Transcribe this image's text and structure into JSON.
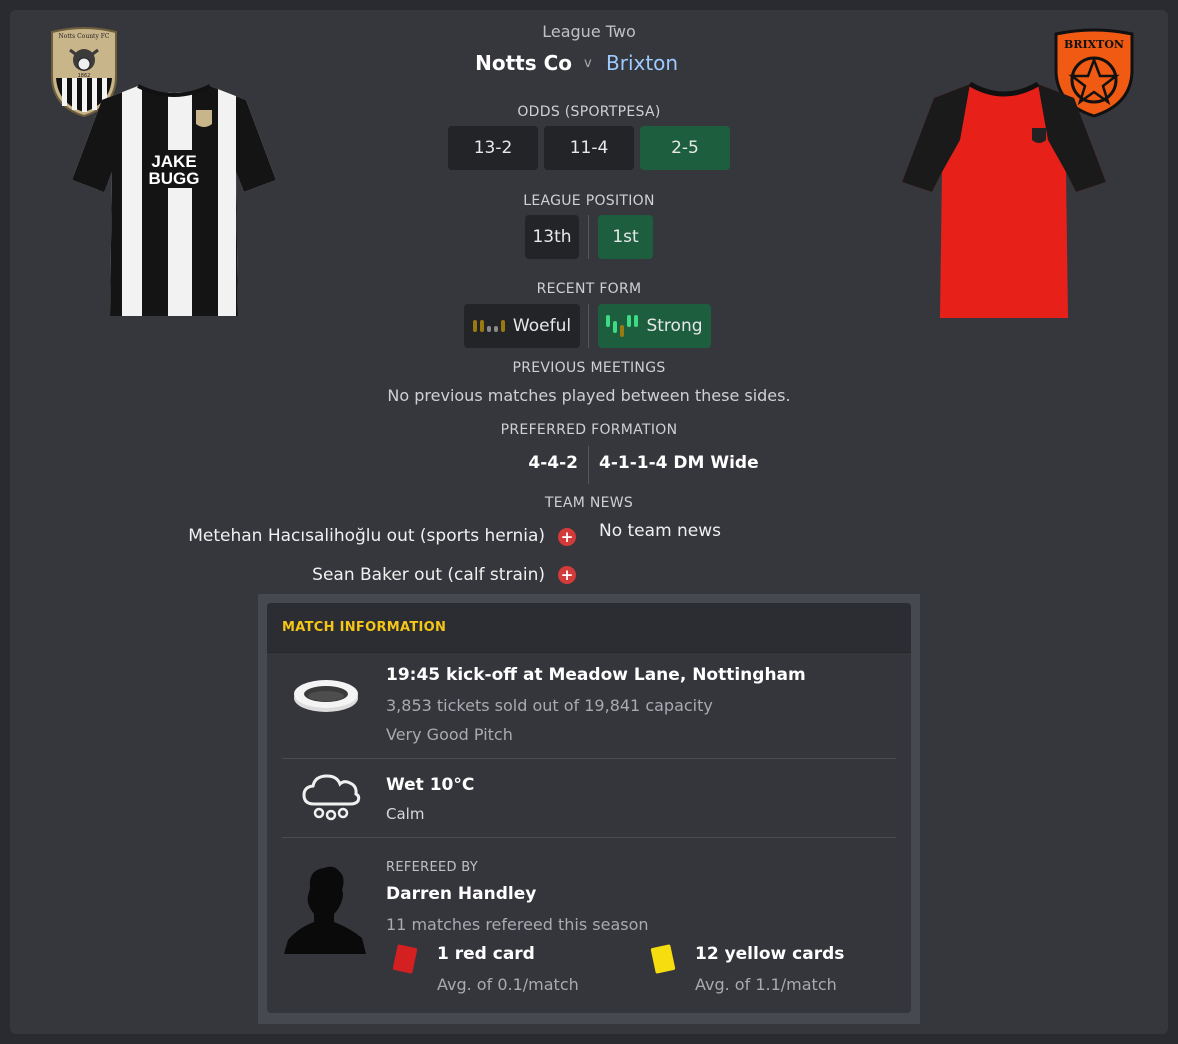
{
  "match": {
    "competition": "League Two",
    "home_team": "Notts Co",
    "vs": "v",
    "away_team": "Brixton"
  },
  "odds": {
    "label": "ODDS (SPORTPESA)",
    "home": "13-2",
    "draw": "11-4",
    "away": "2-5"
  },
  "league_position": {
    "label": "LEAGUE POSITION",
    "home": "13th",
    "away": "1st"
  },
  "recent_form": {
    "label": "RECENT FORM",
    "home": "Woeful",
    "away": "Strong"
  },
  "previous_meetings": {
    "label": "PREVIOUS MEETINGS",
    "text": "No previous matches played between these sides."
  },
  "preferred_formation": {
    "label": "PREFERRED FORMATION",
    "home": "4-4-2",
    "away": "4-1-1-4 DM Wide"
  },
  "team_news": {
    "label": "TEAM NEWS",
    "home": [
      "Metehan Hacısalihoğlu out (sports hernia)",
      "Sean Baker out (calf strain)"
    ],
    "away": "No team news"
  },
  "match_info": {
    "title": "MATCH INFORMATION",
    "kickoff": "19:45 kick-off at Meadow Lane, Nottingham",
    "tickets": "3,853 tickets sold out of 19,841 capacity",
    "pitch": "Very Good Pitch",
    "weather": "Wet 10°C",
    "wind": "Calm",
    "referee_label": "REFEREED BY",
    "referee": "Darren Handley",
    "referee_matches": "11 matches refereed this season",
    "red_cards": "1 red card",
    "red_avg": "Avg. of 0.1/match",
    "yellow_cards": "12 yellow cards",
    "yellow_avg": "Avg. of 1.1/match"
  },
  "badges": {
    "home_badge_text": "Notts County FC",
    "home_badge_year": "1862",
    "home_sponsor_line1": "JAKE",
    "home_sponsor_line2": "BUGG",
    "away_badge_text": "BRIXTON"
  },
  "colors": {
    "green_box": "#1d5e3e",
    "away_link": "#9ecbff",
    "accent_yellow": "#f5c518",
    "injury_red": "#d33a3a"
  }
}
